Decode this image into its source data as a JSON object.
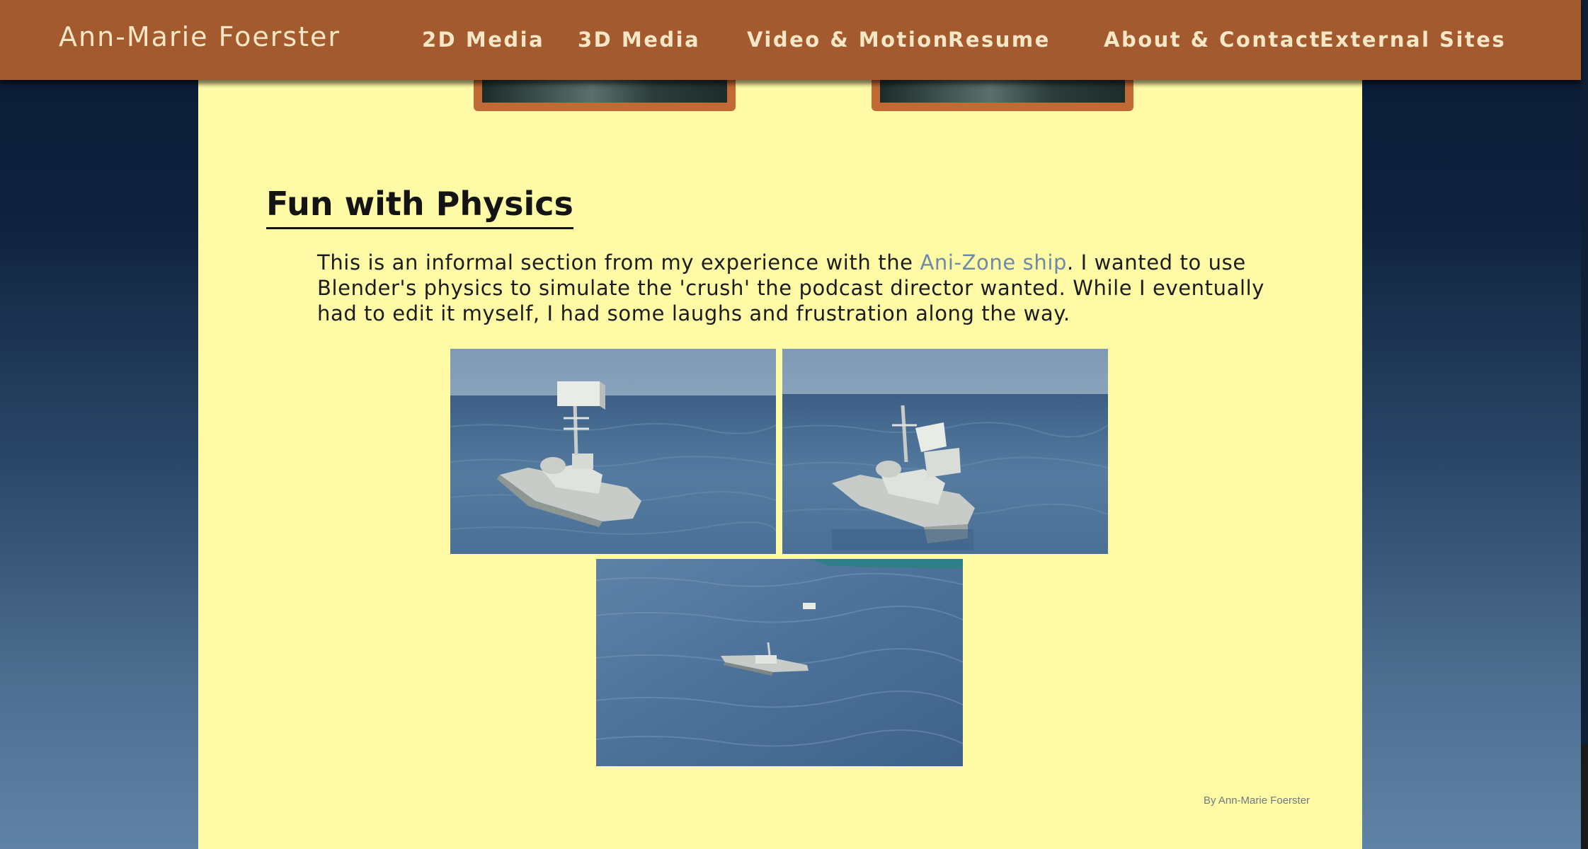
{
  "header": {
    "brand": "Ann-Marie Foerster",
    "nav": [
      "2D Media",
      "3D Media",
      "Video & Motion",
      "Resume",
      "About & Contact",
      "External Sites"
    ]
  },
  "section": {
    "title": "Fun with Physics",
    "text_before_link": "This is an informal section from my experience with the ",
    "link_text": "Ani-Zone ship",
    "text_after_link": ". I wanted to use Blender's physics to simulate the 'crush' the podcast director wanted. While I eventually had to edit it myself, I had some laughs and frustration along the way."
  },
  "footer": {
    "credit": "By Ann-Marie Foerster"
  },
  "colors": {
    "header_bg": "#a45a2f",
    "panel_bg": "#fffaa6",
    "link": "#6d8aa8",
    "nav_text": "#f6e7c6"
  }
}
